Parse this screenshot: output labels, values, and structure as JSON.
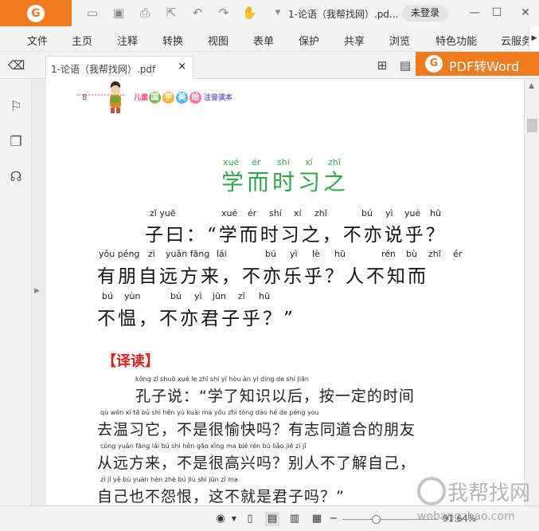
{
  "titlebar": {
    "doc_title": "1-论语（我帮找网）.pd...",
    "login": "未登录",
    "icons": [
      "folder-icon",
      "save-icon",
      "print-icon",
      "export-icon",
      "undo-icon",
      "redo-icon",
      "hand-icon",
      "dropdown-icon"
    ]
  },
  "menu": {
    "items": [
      "文件",
      "主页",
      "注释",
      "转换",
      "视图",
      "表单",
      "保护",
      "共享",
      "浏览",
      "特色功能",
      "云服务"
    ]
  },
  "tab": {
    "label": "1-论语（我帮找网）.pdf",
    "close": "×"
  },
  "pdf_to_word": {
    "label": "PDF转Word"
  },
  "page": {
    "header_number": "8",
    "header_prefix": "儿童",
    "header_chars": [
      "国",
      "学",
      "美",
      "绘"
    ],
    "header_suffix": "注音读本",
    "title_pinyin": [
      "xué",
      "ér",
      "shí",
      "xí",
      "zhī"
    ],
    "title": "学而时习之",
    "text_lines": [
      {
        "pinyin": [
          "zǐ yuē",
          "xué",
          "ér",
          "shí",
          "xí",
          "zhī",
          "bú",
          "yì",
          "yuè",
          "hū"
        ],
        "hanzi": "子曰：“学而时习之，不亦说乎？"
      },
      {
        "pinyin": [
          "yǒu péng",
          "zì",
          "yuǎn fāng",
          "lái",
          "bú",
          "yì",
          "lè",
          "hū",
          "rén",
          "bù",
          "zhī",
          "ér"
        ],
        "hanzi": "有朋自远方来，不亦乐乎？人不知而"
      },
      {
        "pinyin": [
          "bú",
          "yùn",
          "bú",
          "yì",
          "jūn",
          "zǐ",
          "hū"
        ],
        "hanzi": "不愠，不亦君子乎？”"
      }
    ],
    "translation_heading": "【译读】",
    "translation_lines": [
      {
        "pinyin": "kǒng  zǐ  shuō          xué  le  zhī  shi  yǐ  hòu       àn  yí  dìng  de  shí  jiān",
        "hanzi": "孔子说：“学了知识以后，按一定的时间"
      },
      {
        "pinyin": "qù  wēn  xí  tā      bú  shì  hěn  yú  kuài  ma   yǒu  zhì  tóng  dào  hé  de  péng  you",
        "hanzi": "去温习它，不是很愉快吗？有志同道合的朋友"
      },
      {
        "pinyin": "cóng  yuǎn  fāng  lái     bú  shì  hěn  gāo  xìng  ma   bié  rén  bù  liǎo  jiě  zì  jǐ",
        "hanzi": "从远方来，不是很高兴吗？别人不了解自己，"
      },
      {
        "pinyin": "zì  jǐ  yě  bù  yuàn  hèn    zhè  bú  jiù  shì  jūn  zǐ  ma",
        "hanzi": "自己也不怨恨，这不就是君子吗？”"
      }
    ]
  },
  "statusbar": {
    "zoom": "91.64%",
    "zoom_fraction": 0.35
  },
  "watermark": {
    "text": "我帮找网",
    "url": "wobangzhao.com"
  },
  "colors": {
    "brand": "#f07a1e",
    "title_green": "#2da84c",
    "heading_red": "#dd2222"
  }
}
